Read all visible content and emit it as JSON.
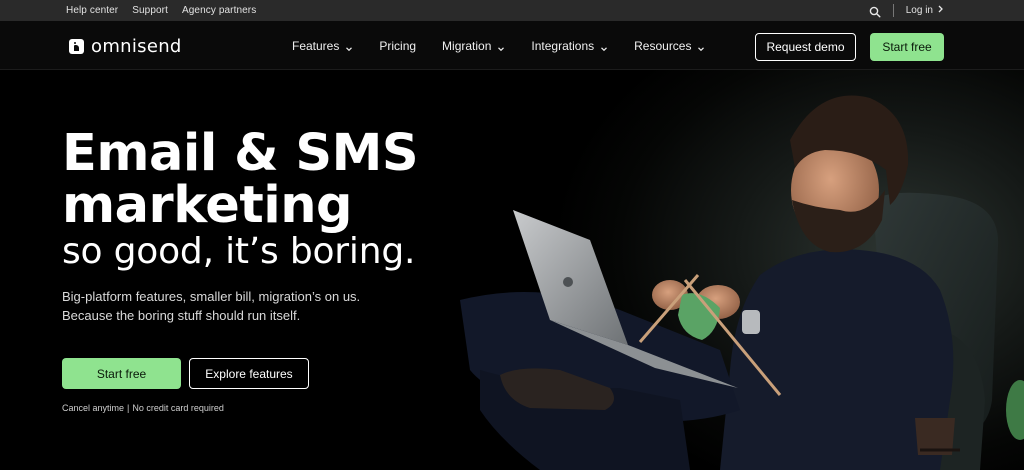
{
  "utility_bar": {
    "links": [
      "Help center",
      "Support",
      "Agency partners"
    ],
    "login_label": "Log in"
  },
  "nav": {
    "logo_text": "omnisend",
    "items": [
      {
        "label": "Features",
        "dropdown": true
      },
      {
        "label": "Pricing",
        "dropdown": false
      },
      {
        "label": "Migration",
        "dropdown": true
      },
      {
        "label": "Integrations",
        "dropdown": true
      },
      {
        "label": "Resources",
        "dropdown": true
      }
    ],
    "request_demo_label": "Request demo",
    "start_free_label": "Start free"
  },
  "hero": {
    "title_line1": "Email & SMS",
    "title_line2": "marketing",
    "subtitle": "so good, it’s boring.",
    "description_line1": "Big-platform features, smaller bill, migration’s on us.",
    "description_line2": "Because the boring stuff should run itself.",
    "primary_cta": "Start free",
    "secondary_cta": "Explore features",
    "note_part1": "Cancel anytime",
    "note_separator": "|",
    "note_part2": "No credit card required"
  },
  "colors": {
    "accent_green": "#8fe38f",
    "background": "#000000",
    "utility_bar_bg": "#2a2a2a"
  },
  "icons": {
    "search": "search-icon",
    "login_arrow": "chevron-right-icon",
    "nav_dropdown": "chevron-down-icon",
    "logo": "omnisend-logo-icon"
  }
}
